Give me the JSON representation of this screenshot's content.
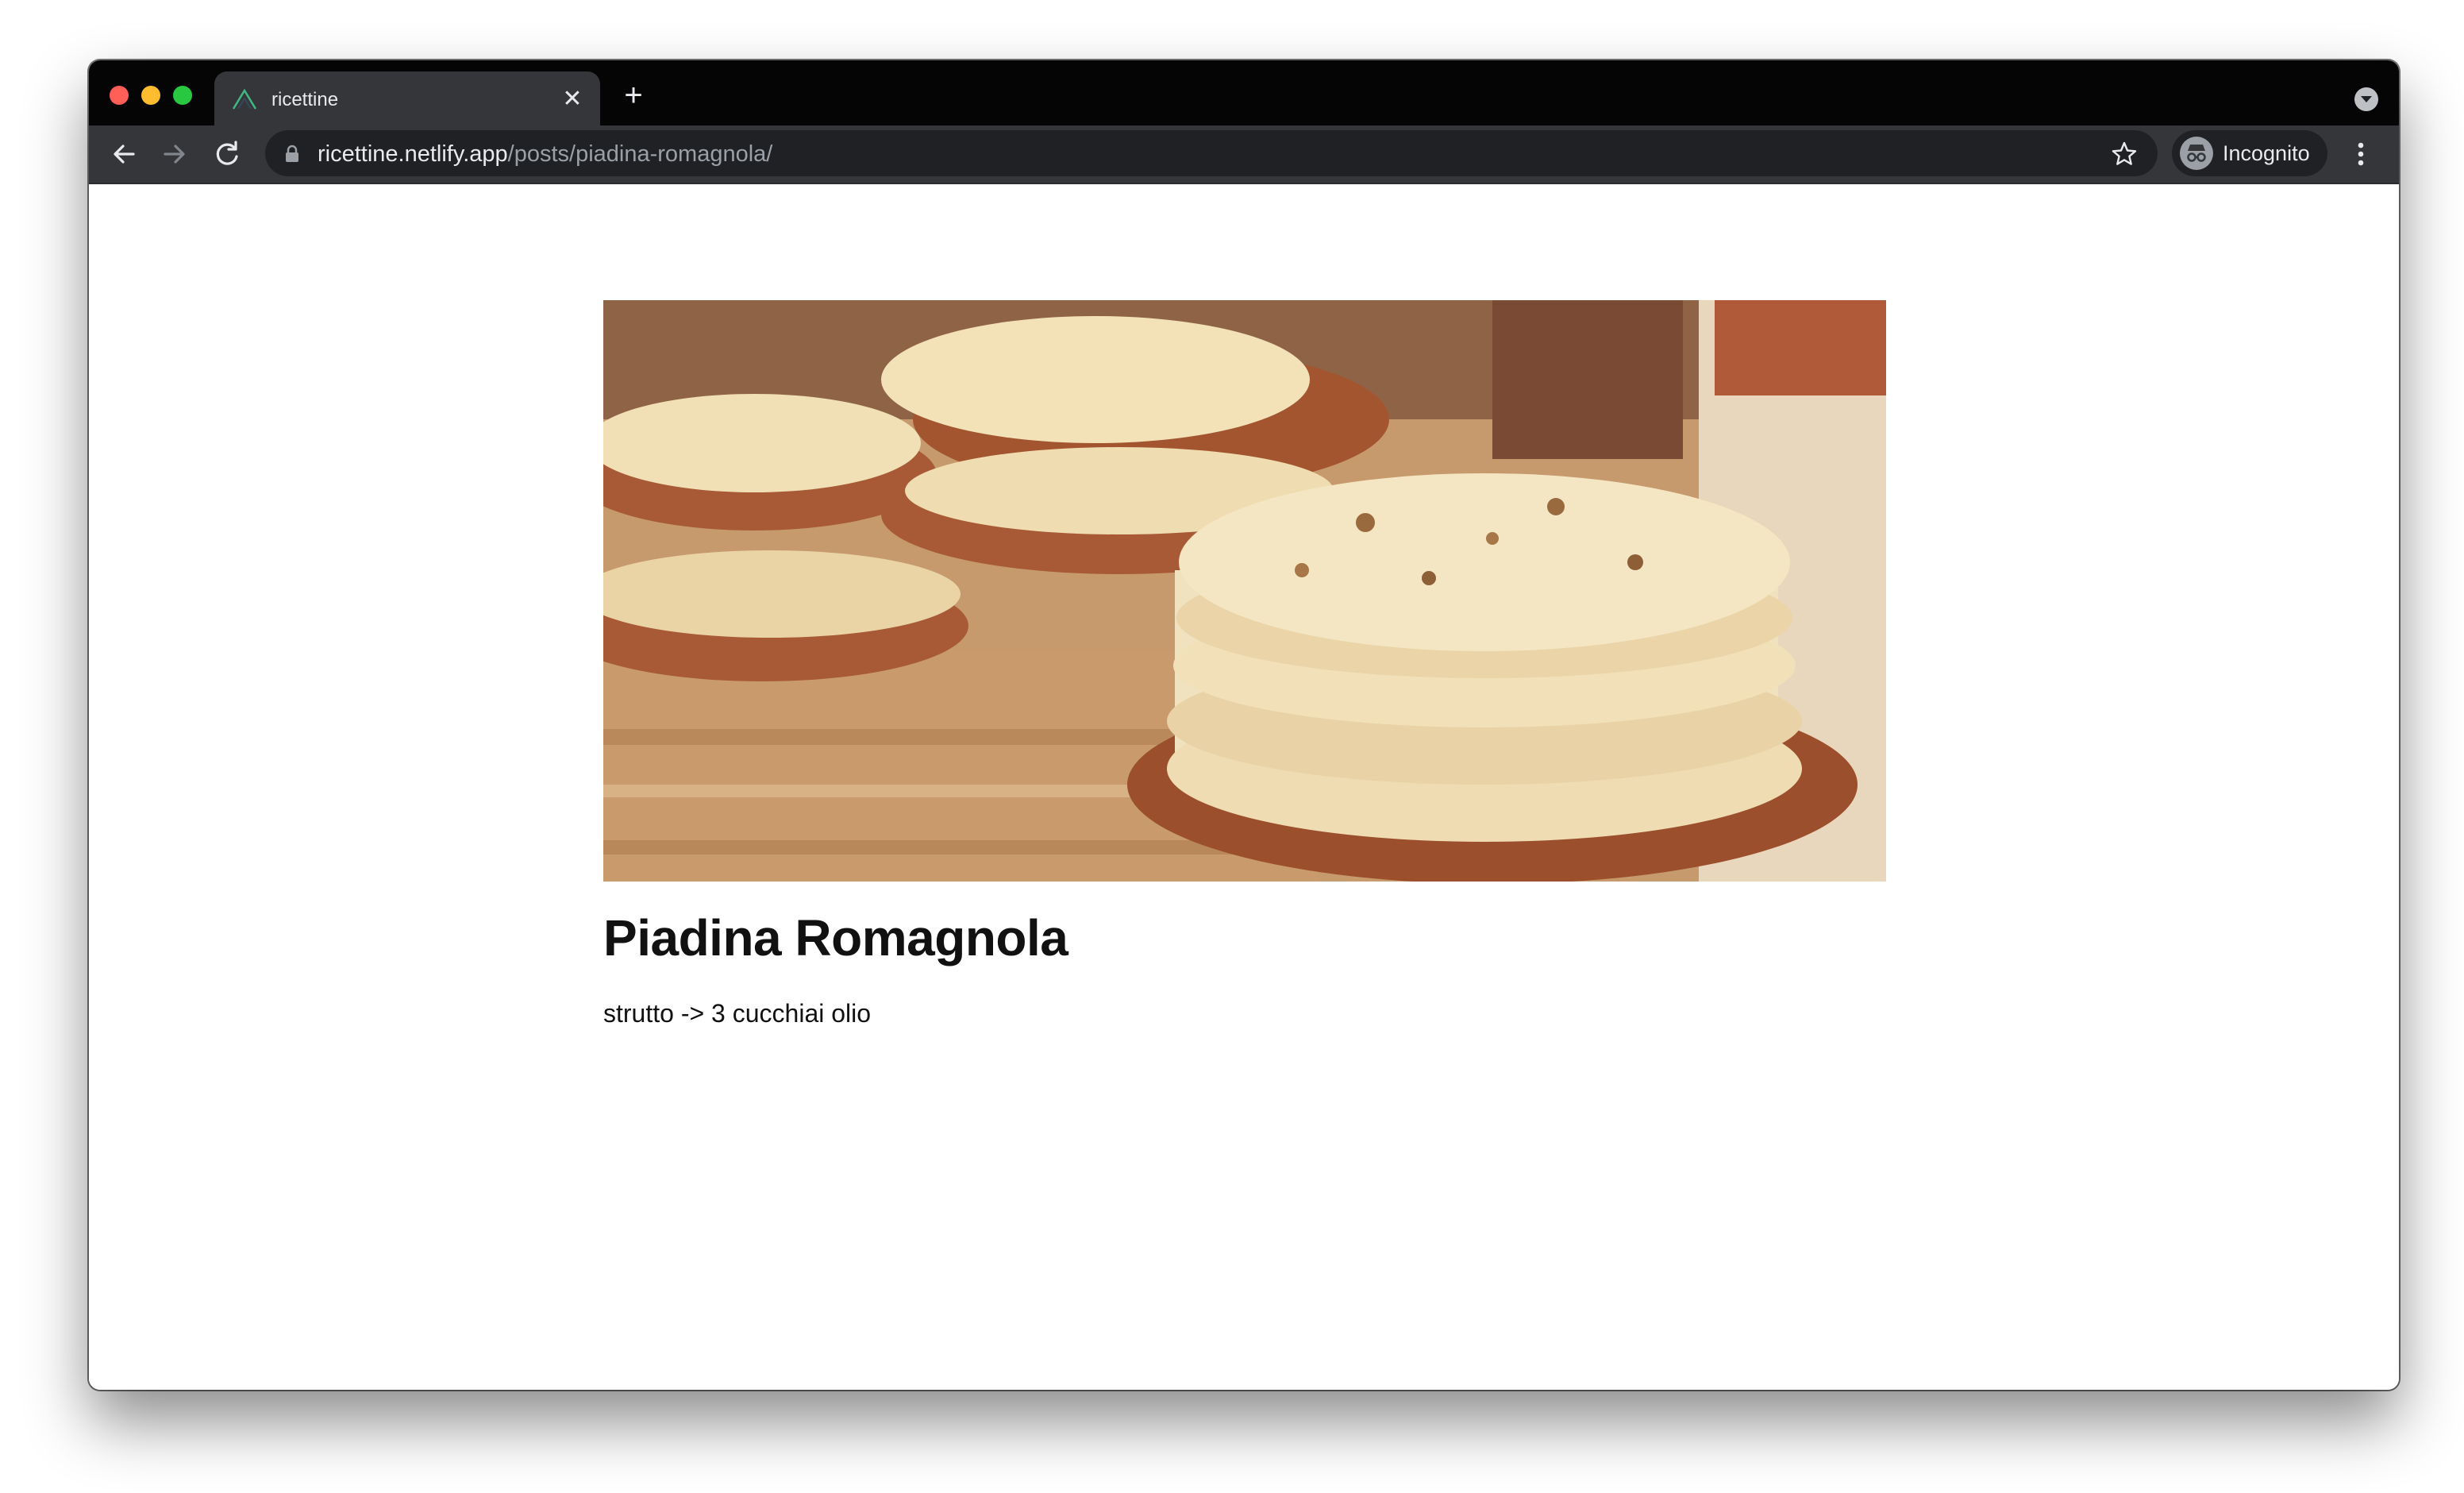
{
  "browser": {
    "tab": {
      "title": "ricettine",
      "favicon": "netlify-triangle-icon"
    },
    "url": {
      "host": "ricettine.netlify.app",
      "path": "/posts/piadina-romagnola/"
    },
    "profile_label": "Incognito",
    "icons": {
      "back": "arrow-left-icon",
      "forward": "arrow-right-icon",
      "reload": "reload-icon",
      "lock": "lock-icon",
      "bookmark": "star-icon",
      "menu": "kebab-menu-icon",
      "new_tab": "plus-icon",
      "close_tab": "close-icon",
      "tab_search": "chevron-down-icon"
    }
  },
  "post": {
    "title": "Piadina Romagnola",
    "body": "strutto -> 3 cucchiai olio",
    "image_subject": "stacks of piadina flatbreads on wicker baskets"
  },
  "colors": {
    "tabstrip": "#050505",
    "toolbar": "#35363a",
    "omnibox": "#202124",
    "page_bg": "#ffffff",
    "text": "#111111"
  }
}
